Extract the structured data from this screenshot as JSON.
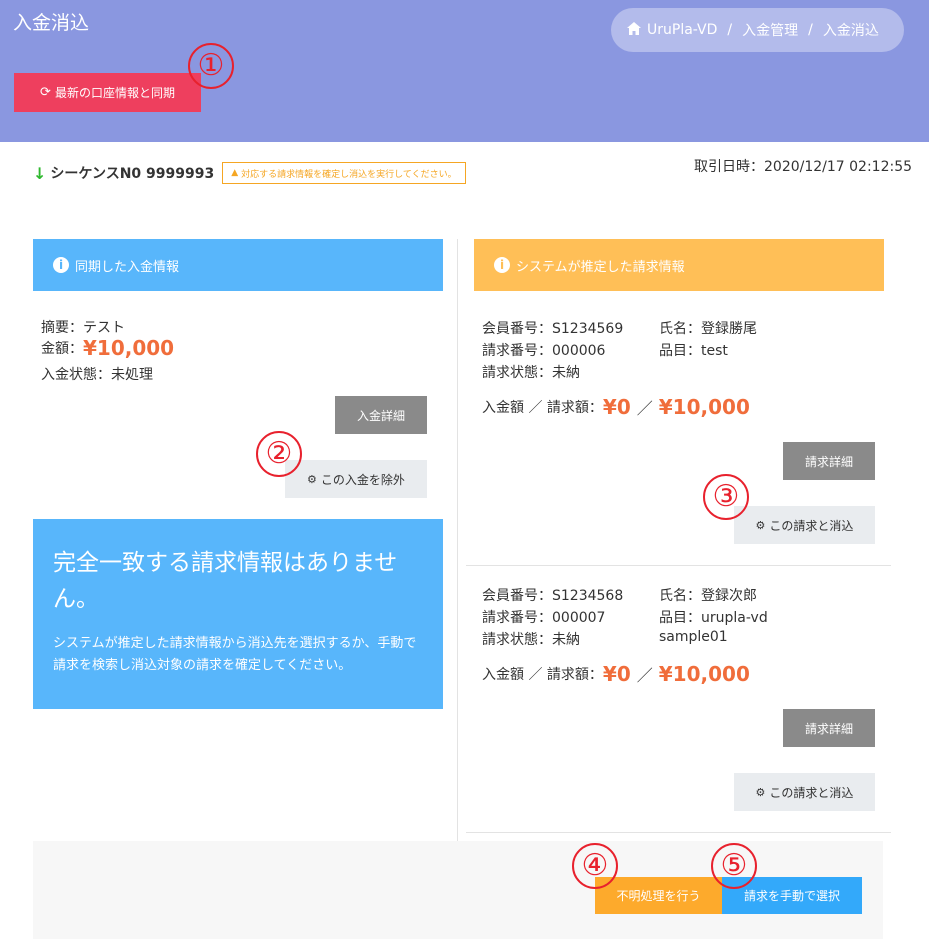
{
  "page": {
    "title": "入金消込"
  },
  "breadcrumb": {
    "home_icon": "home-icon",
    "items": [
      "UruPla-VD",
      "入金管理",
      "入金消込"
    ],
    "separator": "/"
  },
  "toolbar": {
    "sync_label": "最新の口座情報と同期",
    "sync_icon": "refresh-icon"
  },
  "markers": [
    "①",
    "②",
    "③",
    "④",
    "⑤"
  ],
  "sequence": {
    "arrow": "↓",
    "label": "シーケンスN0 9999993",
    "warning": "対応する請求情報を確定し消込を実行してください。",
    "trade_date": "取引日時：2020/12/17 02:12:55"
  },
  "deposit": {
    "header": "同期した入金情報",
    "summary": "摘要：テスト",
    "amount_label": "金額：",
    "amount": "¥10,000",
    "status": "入金状態：未処理",
    "detail_button": "入金詳細",
    "exclude_button": "この入金を除外"
  },
  "no_match": {
    "title": "完全一致する請求情報はありません。",
    "message": "システムが推定した請求情報から消込先を選択するか、手動で請求を検索し消込対象の請求を確定してください。"
  },
  "estimated": {
    "header": "システムが推定した請求情報",
    "invoices": [
      {
        "member_no": "会員番号：S1234569",
        "name": "氏名：登録勝尾",
        "invoice_no": "請求番号：000006",
        "item": "品目：test",
        "item_extra": "",
        "status": "請求状態：未納",
        "amount_label": "入金額 ／ 請求額：",
        "paid": "¥0",
        "slash": "／",
        "billed": "¥10,000",
        "detail_button": "請求詳細",
        "reconcile_button": "この請求と消込"
      },
      {
        "member_no": "会員番号：S1234568",
        "name": "氏名：登録次郎",
        "invoice_no": "請求番号：000007",
        "item": "品目：urupla-vd",
        "item_extra": "sample01",
        "status": "請求状態：未納",
        "amount_label": "入金額 ／ 請求額：",
        "paid": "¥0",
        "slash": "／",
        "billed": "¥10,000",
        "detail_button": "請求詳細",
        "reconcile_button": "この請求と消込"
      }
    ]
  },
  "footer": {
    "unknown_button": "不明処理を行う",
    "manual_button": "請求を手動で選択"
  },
  "colors": {
    "header_bg": "#8a97e0",
    "danger": "#ee3f5e",
    "info": "#58b6fb",
    "warning": "#ffbf57",
    "amount": "#f06d3b",
    "marker": "#e8212d"
  }
}
